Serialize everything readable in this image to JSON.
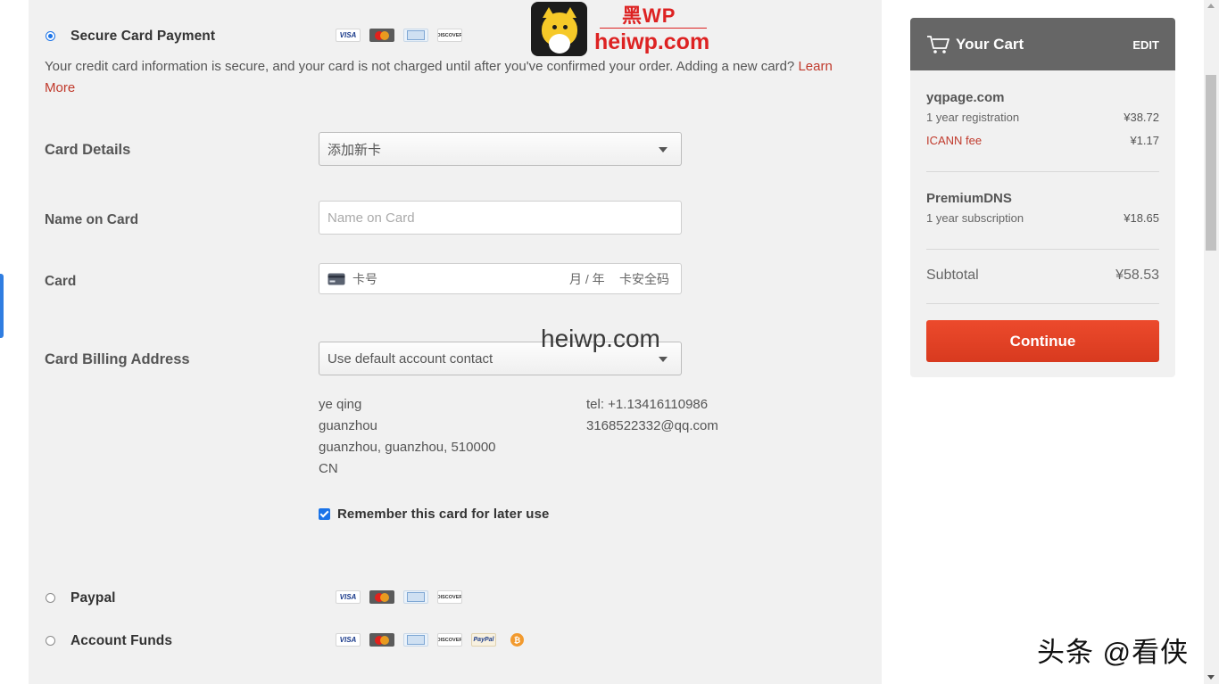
{
  "payment": {
    "secure": {
      "label": "Secure Card Payment",
      "description": "Your credit card information is secure, and your card is not charged until after you've confirmed your order. Adding a new card?",
      "learn_more": "Learn More"
    },
    "card_details": {
      "label": "Card Details",
      "value": "添加新卡"
    },
    "name_on_card": {
      "label": "Name on Card",
      "placeholder": "Name on Card"
    },
    "card": {
      "label": "Card",
      "number_placeholder": "卡号",
      "expiry_placeholder": "月 / 年",
      "cvc_placeholder": "卡安全码"
    },
    "billing": {
      "label": "Card Billing Address",
      "value": "Use default account contact",
      "address": [
        "ye qing",
        "guanzhou",
        "guanzhou, guanzhou, 510000",
        "CN"
      ],
      "contact": [
        "tel: +1.13416110986",
        "3168522332@qq.com"
      ]
    },
    "remember": {
      "label": "Remember this card for later use",
      "checked": true
    },
    "paypal": {
      "label": "Paypal"
    },
    "funds": {
      "label": "Account Funds"
    },
    "logos": {
      "visa": "VISA",
      "discover": "DISCOVER",
      "paypal": "PayPal",
      "bitcoin": "₿"
    }
  },
  "cart": {
    "title": "Your Cart",
    "edit": "EDIT",
    "items": [
      {
        "name": "yqpage.com",
        "line": "1 year registration",
        "price": "¥38.72",
        "fee_label": "ICANN fee",
        "fee_price": "¥1.17"
      },
      {
        "name": "PremiumDNS",
        "line": "1 year subscription",
        "price": "¥18.65"
      }
    ],
    "subtotal_label": "Subtotal",
    "subtotal": "¥58.53",
    "continue": "Continue",
    "accent_color": "#e2432a"
  },
  "watermarks": {
    "logo_title": "黑WP",
    "logo_url": "heiwp.com",
    "center": "heiwp.com",
    "corner": "头条 @看侠"
  }
}
